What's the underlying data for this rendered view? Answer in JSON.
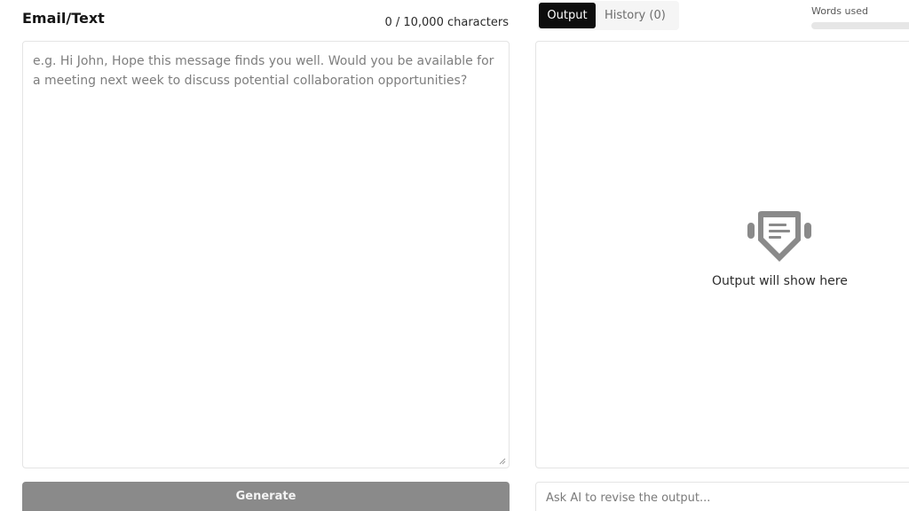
{
  "left": {
    "title": "Email/Text",
    "char_count": "0 / 10,000 characters",
    "input_placeholder": "e.g. Hi John, Hope this message finds you well. Would you be available for a meeting next week to discuss potential collaboration opportunities?",
    "generate_label": "Generate"
  },
  "right": {
    "tabs": {
      "output_label": "Output",
      "history_label": "History (0)"
    },
    "words_used_label": "Words used",
    "words_used_fraction": 0.0,
    "empty_state_text": "Output will show here",
    "empty_state_icon": "document-shield-icon",
    "revise_placeholder": "Ask AI to revise the output..."
  },
  "colors": {
    "generate_button": "#8a8a8a",
    "active_tab": "#0d0d0d",
    "icon_gray": "#8a8a8a",
    "border": "#e4e4e4"
  }
}
